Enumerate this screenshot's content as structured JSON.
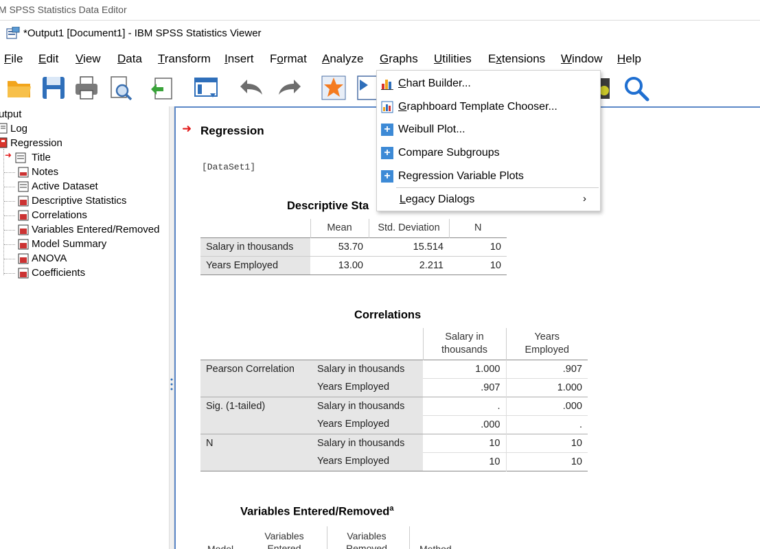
{
  "background_window": {
    "title": "IM SPSS Statistics Data Editor"
  },
  "window": {
    "title": "*Output1 [Document1] - IBM SPSS Statistics Viewer"
  },
  "menu": {
    "file": {
      "pre": "",
      "u": "F",
      "post": "ile"
    },
    "edit": {
      "pre": "",
      "u": "E",
      "post": "dit"
    },
    "view": {
      "pre": "",
      "u": "V",
      "post": "iew"
    },
    "data": {
      "pre": "",
      "u": "D",
      "post": "ata"
    },
    "transform": {
      "pre": "",
      "u": "T",
      "post": "ransform"
    },
    "insert": {
      "pre": "",
      "u": "I",
      "post": "nsert"
    },
    "format": {
      "pre": "F",
      "u": "o",
      "post": "rmat"
    },
    "analyze": {
      "pre": "",
      "u": "A",
      "post": "nalyze"
    },
    "graphs": {
      "pre": "",
      "u": "G",
      "post": "raphs"
    },
    "utilities": {
      "pre": "",
      "u": "U",
      "post": "tilities"
    },
    "extensions": {
      "pre": "E",
      "u": "x",
      "post": "tensions"
    },
    "window": {
      "pre": "",
      "u": "W",
      "post": "indow"
    },
    "help": {
      "pre": "",
      "u": "H",
      "post": "elp"
    }
  },
  "graphs_menu": {
    "chart_builder": {
      "u": "C",
      "post": "hart Builder..."
    },
    "graphboard": {
      "u": "G",
      "post": "raphboard Template Chooser..."
    },
    "weibull": "Weibull Plot...",
    "compare": "Compare Subgroups",
    "regression_plots": "Regression Variable Plots",
    "legacy": {
      "u": "L",
      "post": "egacy Dialogs"
    },
    "legacy_arrow": "›"
  },
  "outline": {
    "root": "utput",
    "log": "Log",
    "regression": "Regression",
    "items": [
      "Title",
      "Notes",
      "Active Dataset",
      "Descriptive Statistics",
      "Correlations",
      "Variables Entered/Removed",
      "Model Summary",
      "ANOVA",
      "Coefficients"
    ]
  },
  "content": {
    "heading": "Regression",
    "dataset": "[DataSet1]",
    "descriptive": {
      "title": "Descriptive Sta",
      "headers": [
        "Mean",
        "Std. Deviation",
        "N"
      ],
      "rows": [
        {
          "label": "Salary in thousands",
          "values": [
            "53.70",
            "15.514",
            "10"
          ]
        },
        {
          "label": "Years Employed",
          "values": [
            "13.00",
            "2.211",
            "10"
          ]
        }
      ]
    },
    "correlations": {
      "title": "Correlations",
      "col1": [
        "Salary in",
        "thousands"
      ],
      "col2": [
        "Years",
        "Employed"
      ],
      "groups": [
        {
          "label": "Pearson Correlation",
          "rows": [
            {
              "var": "Salary in thousands",
              "v1": "1.000",
              "v2": ".907"
            },
            {
              "var": "Years Employed",
              "v1": ".907",
              "v2": "1.000"
            }
          ]
        },
        {
          "label": "Sig. (1-tailed)",
          "rows": [
            {
              "var": "Salary in thousands",
              "v1": ".",
              "v2": ".000"
            },
            {
              "var": "Years Employed",
              "v1": ".000",
              "v2": "."
            }
          ]
        },
        {
          "label": "N",
          "rows": [
            {
              "var": "Salary in thousands",
              "v1": "10",
              "v2": "10"
            },
            {
              "var": "Years Employed",
              "v1": "10",
              "v2": "10"
            }
          ]
        }
      ]
    },
    "variables": {
      "title": "Variables Entered/Removed",
      "superscript": "a",
      "headers": [
        "Model",
        "Variables Entered",
        "Variables Removed",
        "Method"
      ]
    }
  },
  "colors": {
    "accent_red": "#e04848",
    "selection_border": "#5b87c7",
    "plus_blue": "#3d8ad6"
  }
}
